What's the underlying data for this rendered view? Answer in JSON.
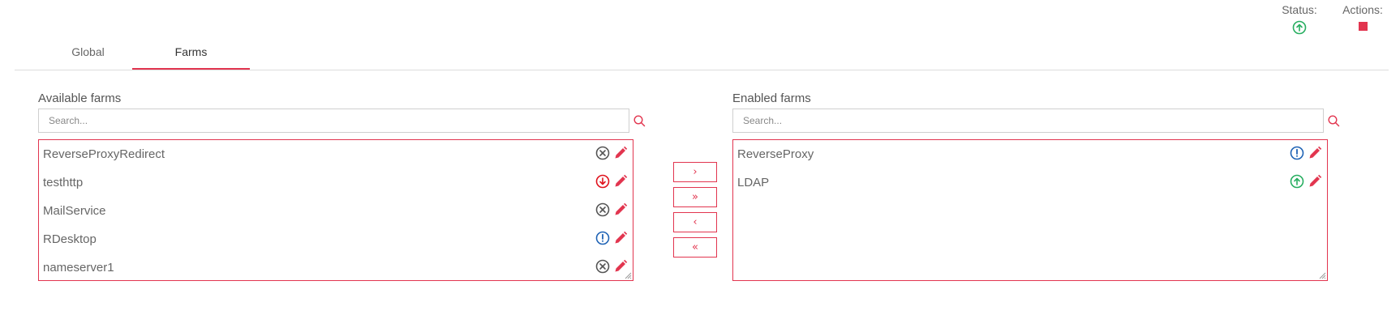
{
  "header": {
    "status_label": "Status:",
    "status_icon": "status-up-icon",
    "actions_label": "Actions:",
    "actions_icon": "stop-icon"
  },
  "tabs": [
    {
      "label": "Global",
      "active": false
    },
    {
      "label": "Farms",
      "active": true
    }
  ],
  "available": {
    "title": "Available farms",
    "search_placeholder": "Search...",
    "farms": [
      {
        "name": "ReverseProxyRedirect",
        "status": "down-icon"
      },
      {
        "name": "testhttp",
        "status": "problem-icon"
      },
      {
        "name": "MailService",
        "status": "down-icon"
      },
      {
        "name": "RDesktop",
        "status": "maintenance-icon"
      },
      {
        "name": "nameserver1",
        "status": "down-icon"
      }
    ]
  },
  "move_buttons": {
    "add_selected": "›",
    "add_all": "»",
    "remove_selected": "‹",
    "remove_all": "«"
  },
  "enabled": {
    "title": "Enabled farms",
    "search_placeholder": "Search...",
    "farms": [
      {
        "name": "ReverseProxy",
        "status": "maintenance-icon"
      },
      {
        "name": "LDAP",
        "status": "up-icon"
      }
    ]
  },
  "colors": {
    "accent": "#e2354f",
    "up": "#27ae60",
    "problem": "#e0131e",
    "maintenance": "#1f63b5",
    "down": "#555555"
  }
}
